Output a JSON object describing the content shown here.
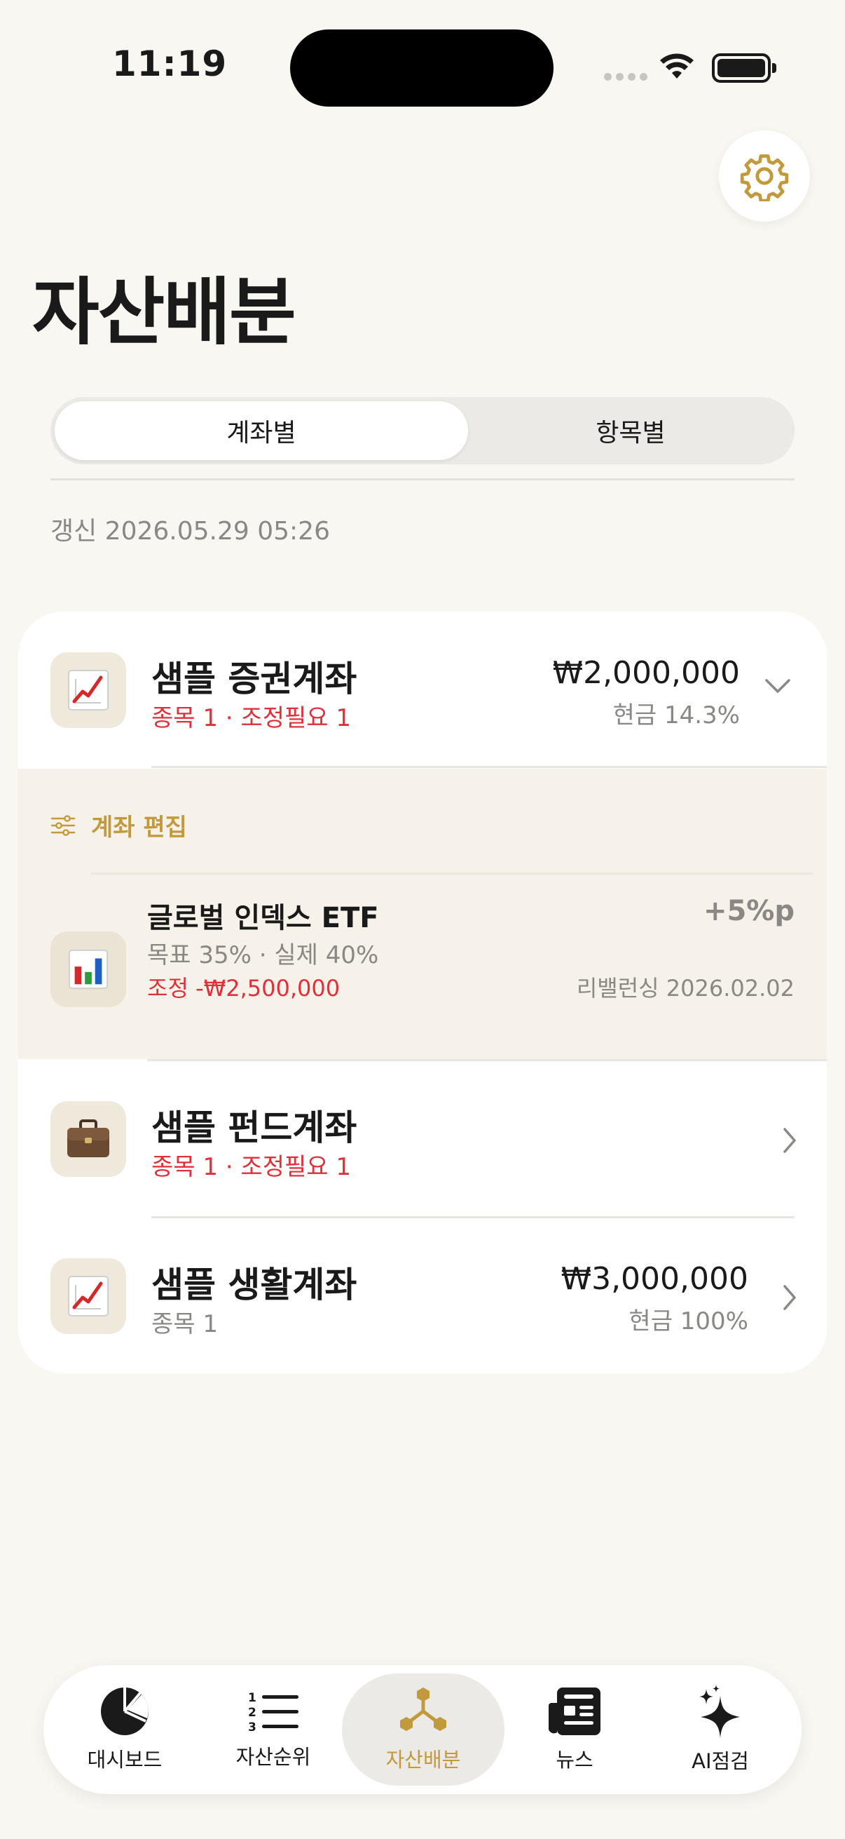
{
  "status_bar": {
    "time": "11:19"
  },
  "header": {
    "title": "자산배분",
    "settings_icon": "gear-icon"
  },
  "segmented": {
    "tabs": [
      "계좌별",
      "항목별"
    ],
    "selected": 0
  },
  "updated_text": "갱신 2026.05.29 05:26",
  "accounts": [
    {
      "icon": "chart-increasing-emoji",
      "name": "샘플 증권계좌",
      "sub": "종목 1 · 조정필요 1",
      "amount": "₩2,000,000",
      "cash": "현금 14.3%",
      "expanded": true,
      "edit_label": "계좌 편집",
      "holdings": [
        {
          "icon": "bar-chart-emoji",
          "name": "글로벌 인덱스 ETF",
          "meta": "목표 35% · 실제 40%",
          "adjust": "조정 -₩2,500,000",
          "diff": "+5%p",
          "rebalance": "리밸런싱 2026.02.02"
        }
      ]
    },
    {
      "icon": "briefcase-emoji",
      "name": "샘플 펀드계좌",
      "sub": "종목 1 · 조정필요 1",
      "amount": "",
      "cash": "",
      "expanded": false
    },
    {
      "icon": "chart-increasing-emoji",
      "name": "샘플 생활계좌",
      "sub": "종목 1",
      "amount": "₩3,000,000",
      "cash": "현금 100%",
      "expanded": false
    }
  ],
  "tabbar": {
    "items": [
      {
        "label": "대시보드",
        "icon": "pie-chart-icon"
      },
      {
        "label": "자산순위",
        "icon": "numbered-list-icon"
      },
      {
        "label": "자산배분",
        "icon": "allocation-nodes-icon"
      },
      {
        "label": "뉴스",
        "icon": "newspaper-icon"
      },
      {
        "label": "AI점검",
        "icon": "sparkles-icon"
      }
    ],
    "active_index": 2
  },
  "colors": {
    "accent": "#c39a3b",
    "alert": "#e0303a",
    "background": "#f9f7f2"
  }
}
